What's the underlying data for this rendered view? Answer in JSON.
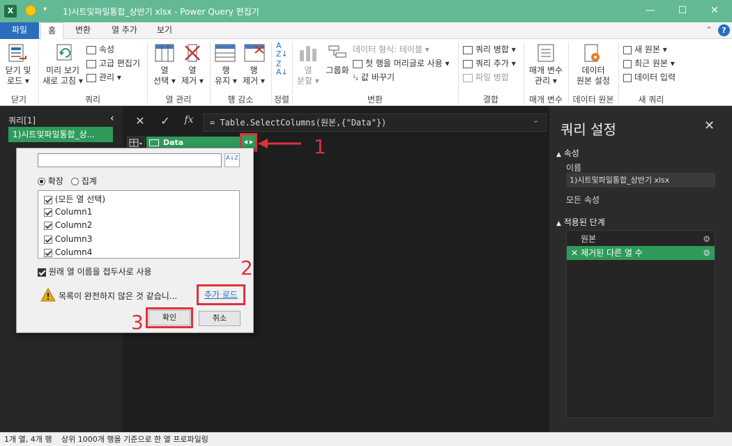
{
  "titlebar": {
    "title": "1)시트및파일통합_상반기 xlsx - Power Query 편집기",
    "app_icon": "X",
    "minimize": "—",
    "maximize": "☐",
    "close": "✕"
  },
  "tabs": {
    "file": "파일",
    "home": "홈",
    "transform": "변환",
    "add_column": "열 추가",
    "view": "보기"
  },
  "ribbon": {
    "close_load": "닫기 및\n로드 ▾",
    "refresh": "미리 보기\n새로 고침 ▾",
    "properties": "속성",
    "advanced_editor": "고급 편집기",
    "manage": "관리 ▾",
    "choose_columns": "열\n선택 ▾",
    "remove_columns": "열\n제거 ▾",
    "keep_rows": "행\n유지 ▾",
    "remove_rows": "행\n제거 ▾",
    "split_column": "열\n분할 ▾",
    "group_by": "그룹화",
    "data_type": "데이터 형식: 테이블 ▾",
    "use_first_row": "첫 행을 머리글로 사용 ▾",
    "replace_values": "값 바꾸기",
    "merge_queries": "쿼리 병합 ▾",
    "append_queries": "쿼리 추가 ▾",
    "combine_files": "파일 병합",
    "manage_params": "매개 변수\n관리 ▾",
    "data_source_settings": "데이터\n원본 설정",
    "new_source": "새 원본 ▾",
    "recent_sources": "최근 원본 ▾",
    "enter_data": "데이터 입력",
    "groups": {
      "close": "닫기",
      "query": "쿼리",
      "manage_cols": "열 관리",
      "reduce_rows": "행 감소",
      "sort": "정렬",
      "transform": "변환",
      "combine": "결합",
      "params": "매개 변수",
      "data_source": "데이터 원본",
      "new_query": "새 쿼리"
    }
  },
  "left_pane": {
    "header": "쿼리[1]",
    "query_item": "1)시트및파일통합_상..."
  },
  "formula": {
    "cancel": "✕",
    "confirm": "✓",
    "fx": "fx",
    "text": "= Table.SelectColumns(원본,{\"Data\"})"
  },
  "column_header": {
    "name": "Data"
  },
  "popup": {
    "search_placeholder": "",
    "sort_icon": "A↓Z",
    "radio_expand": "확장",
    "radio_aggregate": "집계",
    "items": [
      "(모든 열 선택)",
      "Column1",
      "Column2",
      "Column3",
      "Column4"
    ],
    "use_prefix": "원래 열 이름을 접두사로 사용",
    "warning": "목록이 완전하지 않은 것 같습니...",
    "load_more": "추가 로드",
    "ok": "확인",
    "cancel": "취소"
  },
  "annotations": {
    "n1": "1",
    "n2": "2",
    "n3": "3"
  },
  "right_pane": {
    "title": "쿼리 설정",
    "properties": "속성",
    "name_label": "이름",
    "name_value": "1)시트및파일통합_상반기 xlsx",
    "all_properties": "모든 속성",
    "applied_steps": "적용된 단계",
    "steps": [
      "원본",
      "제거된 다른 열 수"
    ]
  },
  "statusbar": {
    "left": "1개 열, 4개 행",
    "right": "상위 1000개 행을 기준으로 한 열 프로파일링"
  }
}
